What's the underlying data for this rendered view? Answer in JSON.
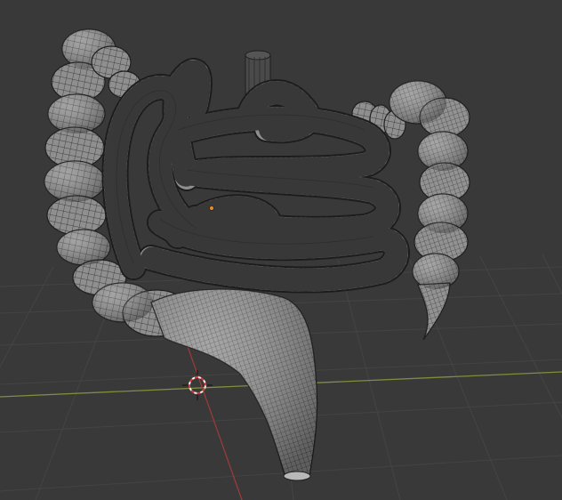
{
  "viewport": {
    "background_color": "#393939",
    "grid_color": "#4a4a4a",
    "x_axis_color": "#8a9a3a",
    "y_axis_color": "#9a3a3a",
    "model_fill_color": "#8f8f8f",
    "model_wire_color": "#1e1e1e",
    "cursor_colors": [
      "#d04040",
      "#f0f0f0"
    ],
    "origin_color": "#e08a2a"
  },
  "scene": {
    "parts": [
      "cecum",
      "ascending-colon",
      "transverse-colon",
      "descending-colon",
      "sigmoid-colon",
      "rectum",
      "small-intestine",
      "appendix"
    ]
  },
  "icons": {
    "cursor": "3d-cursor-icon",
    "origin": "object-origin-icon"
  }
}
